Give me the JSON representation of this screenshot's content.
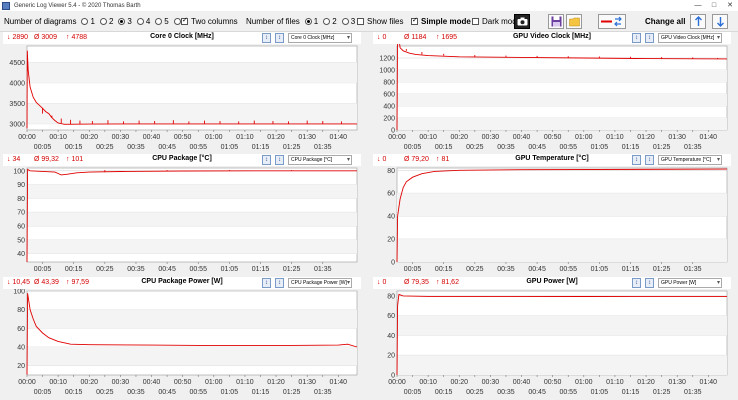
{
  "window": {
    "title": "Generic Log Viewer 5.4 - © 2020 Thomas Barth"
  },
  "toolbar": {
    "diagrams_label": "Number of diagrams",
    "diagram_options": [
      "1",
      "2",
      "3",
      "4",
      "5",
      "6"
    ],
    "diagrams_selected": "3",
    "two_columns_label": "Two columns",
    "files_label": "Number of files",
    "file_options": [
      "1",
      "2",
      "3"
    ],
    "files_selected": "1",
    "show_files_label": "Show files",
    "simple_mode_label": "Simple mode",
    "dark_mode_label": "Dark mod",
    "change_all_label": "Change all"
  },
  "colors": {
    "series": "#e00000",
    "accent": "#2b6fd6"
  },
  "panels": [
    {
      "stats": {
        "min": "↓ 2890",
        "avg": "Ø 3009",
        "max": "↑ 4788"
      },
      "title": "Core 0 Clock [MHz]",
      "select": "Core 0 Clock [MHz]"
    },
    {
      "stats": {
        "min": "↓ 0",
        "avg": "Ø 1184",
        "max": "↑ 1695"
      },
      "title": "GPU Video Clock [MHz]",
      "select": "GPU Video Clock [MHz]"
    },
    {
      "stats": {
        "min": "↓ 34",
        "avg": "Ø 99,32",
        "max": "↑ 101"
      },
      "title": "CPU Package [°C]",
      "select": "CPU Package [°C]"
    },
    {
      "stats": {
        "min": "↓ 0",
        "avg": "Ø 79,20",
        "max": "↑ 81"
      },
      "title": "GPU Temperature [°C]",
      "select": "GPU Temperature [°C]"
    },
    {
      "stats": {
        "min": "↓ 10,45",
        "avg": "Ø 43,39",
        "max": "↑ 97,59"
      },
      "title": "CPU Package Power [W]",
      "select": "CPU Package Power [W]"
    },
    {
      "stats": {
        "min": "↓ 0",
        "avg": "Ø 79,35",
        "max": "↑ 81,62"
      },
      "title": "GPU Power [W]",
      "select": "GPU Power [W]"
    }
  ],
  "chart_data": [
    {
      "type": "line",
      "title": "Core 0 Clock [MHz]",
      "ylim": [
        2850,
        4900
      ],
      "yticks": [
        3000,
        3500,
        4000,
        4500
      ],
      "x_top": [
        "00:00",
        "00:10",
        "00:20",
        "00:30",
        "00:40",
        "00:50",
        "01:00",
        "01:10",
        "01:20",
        "01:30",
        "01:40"
      ],
      "x_bottom": [
        "00:05",
        "00:15",
        "00:25",
        "00:35",
        "00:45",
        "00:55",
        "01:05",
        "01:15",
        "01:25",
        "01:35"
      ],
      "points": [
        [
          0,
          2890
        ],
        [
          0.1,
          4788
        ],
        [
          0.4,
          4300
        ],
        [
          1,
          3900
        ],
        [
          2,
          3650
        ],
        [
          3,
          3520
        ],
        [
          4,
          3450
        ],
        [
          5,
          3380
        ],
        [
          6,
          3300
        ],
        [
          7,
          3250
        ],
        [
          8,
          3150
        ],
        [
          9,
          3080
        ],
        [
          10,
          3020
        ],
        [
          12,
          2990
        ],
        [
          20,
          2995
        ],
        [
          40,
          3000
        ],
        [
          60,
          3000
        ],
        [
          80,
          3000
        ],
        [
          100,
          3000
        ],
        [
          106,
          3000
        ]
      ],
      "spikes": [
        [
          5,
          3250
        ],
        [
          8,
          3200
        ],
        [
          11,
          3130
        ],
        [
          14,
          3100
        ],
        [
          17,
          3080
        ],
        [
          21,
          3070
        ],
        [
          26,
          3090
        ],
        [
          31,
          3060
        ],
        [
          36,
          3080
        ],
        [
          41,
          3070
        ],
        [
          47,
          3090
        ],
        [
          52,
          3060
        ],
        [
          57,
          3080
        ],
        [
          62,
          3070
        ],
        [
          68,
          3060
        ],
        [
          73,
          3080
        ],
        [
          79,
          3070
        ],
        [
          84,
          3060
        ],
        [
          90,
          3080
        ],
        [
          95,
          3070
        ],
        [
          101,
          3060
        ]
      ]
    },
    {
      "type": "line",
      "title": "GPU Video Clock [MHz]",
      "ylim": [
        0,
        1400
      ],
      "yticks": [
        0,
        200,
        400,
        600,
        800,
        1000,
        1200
      ],
      "x_top": [
        "00:00",
        "00:10",
        "00:20",
        "00:30",
        "00:40",
        "00:50",
        "01:00",
        "01:10",
        "01:20",
        "01:30",
        "01:40"
      ],
      "x_bottom": [
        "00:05",
        "00:15",
        "00:25",
        "00:35",
        "00:45",
        "00:55",
        "01:05",
        "01:15",
        "01:25",
        "01:35"
      ],
      "points": [
        [
          0,
          0
        ],
        [
          0.2,
          1695
        ],
        [
          1,
          1370
        ],
        [
          2,
          1320
        ],
        [
          4,
          1280
        ],
        [
          6,
          1260
        ],
        [
          10,
          1240
        ],
        [
          20,
          1220
        ],
        [
          40,
          1210
        ],
        [
          60,
          1200
        ],
        [
          80,
          1190
        ],
        [
          106,
          1185
        ]
      ],
      "spikes": [
        [
          3,
          1350
        ],
        [
          8,
          1300
        ],
        [
          15,
          1270
        ],
        [
          25,
          1250
        ],
        [
          35,
          1240
        ],
        [
          45,
          1235
        ],
        [
          55,
          1230
        ],
        [
          65,
          1225
        ],
        [
          75,
          1220
        ],
        [
          85,
          1215
        ],
        [
          95,
          1210
        ],
        [
          103,
          1200
        ]
      ]
    },
    {
      "type": "line",
      "title": "CPU Package [°C]",
      "ylim": [
        34,
        102
      ],
      "yticks": [
        40,
        50,
        60,
        70,
        80,
        90,
        100
      ],
      "x_top": [
        "00:05",
        "00:15",
        "00:25",
        "00:35",
        "00:45",
        "00:55",
        "01:05",
        "01:15",
        "01:25",
        "01:35"
      ],
      "x_bottom": [],
      "points": [
        [
          0,
          34
        ],
        [
          0.2,
          101
        ],
        [
          1,
          100
        ],
        [
          9,
          99
        ],
        [
          10,
          98
        ],
        [
          11,
          97
        ],
        [
          13,
          97.5
        ],
        [
          16,
          98.5
        ],
        [
          20,
          99
        ],
        [
          30,
          99.5
        ],
        [
          50,
          99.8
        ],
        [
          80,
          100
        ],
        [
          106,
          100
        ]
      ],
      "spikes": [
        [
          25,
          100.5
        ],
        [
          45,
          100.5
        ],
        [
          65,
          100.5
        ],
        [
          85,
          100.5
        ]
      ]
    },
    {
      "type": "line",
      "title": "GPU Temperature [°C]",
      "ylim": [
        0,
        82
      ],
      "yticks": [
        0,
        20,
        40,
        60,
        80
      ],
      "x_top": [
        "00:05",
        "00:15",
        "00:25",
        "00:35",
        "00:45",
        "00:55",
        "01:05",
        "01:15",
        "01:25",
        "01:35"
      ],
      "x_bottom": [],
      "points": [
        [
          0,
          0
        ],
        [
          0.2,
          40
        ],
        [
          1,
          55
        ],
        [
          2,
          65
        ],
        [
          3,
          70
        ],
        [
          5,
          74
        ],
        [
          8,
          77
        ],
        [
          12,
          79
        ],
        [
          20,
          80
        ],
        [
          40,
          80.5
        ],
        [
          106,
          81
        ]
      ],
      "spikes": []
    },
    {
      "type": "line",
      "title": "CPU Package Power [W]",
      "ylim": [
        10,
        100
      ],
      "yticks": [
        20,
        40,
        60,
        80,
        100
      ],
      "x_top": [
        "00:00",
        "00:10",
        "00:20",
        "00:30",
        "00:40",
        "00:50",
        "01:00",
        "01:10",
        "01:20",
        "01:30",
        "01:40"
      ],
      "x_bottom": [
        "00:05",
        "00:15",
        "00:25",
        "00:35",
        "00:45",
        "00:55",
        "01:05",
        "01:15",
        "01:25",
        "01:35"
      ],
      "points": [
        [
          0,
          10.45
        ],
        [
          0.2,
          97.59
        ],
        [
          1,
          80
        ],
        [
          2,
          70
        ],
        [
          3,
          62
        ],
        [
          5,
          55
        ],
        [
          7,
          50
        ],
        [
          10,
          46
        ],
        [
          14,
          43
        ],
        [
          20,
          42.5
        ],
        [
          40,
          42
        ],
        [
          60,
          41.5
        ],
        [
          80,
          41.5
        ],
        [
          100,
          42
        ],
        [
          103,
          43
        ],
        [
          106,
          40
        ]
      ],
      "spikes": []
    },
    {
      "type": "line",
      "title": "GPU Power [W]",
      "ylim": [
        0,
        85
      ],
      "yticks": [
        0,
        20,
        40,
        60,
        80
      ],
      "x_top": [
        "00:00",
        "00:10",
        "00:20",
        "00:30",
        "00:40",
        "00:50",
        "01:00",
        "01:10",
        "01:20",
        "01:30",
        "01:40"
      ],
      "x_bottom": [
        "00:05",
        "00:15",
        "00:25",
        "00:35",
        "00:45",
        "00:55",
        "01:05",
        "01:15",
        "01:25",
        "01:35"
      ],
      "points": [
        [
          0,
          0
        ],
        [
          0.2,
          70
        ],
        [
          0.6,
          81.6
        ],
        [
          2,
          80
        ],
        [
          10,
          79.5
        ],
        [
          30,
          79.3
        ],
        [
          60,
          79.4
        ],
        [
          90,
          79.3
        ],
        [
          106,
          79.3
        ]
      ],
      "spikes": []
    }
  ]
}
